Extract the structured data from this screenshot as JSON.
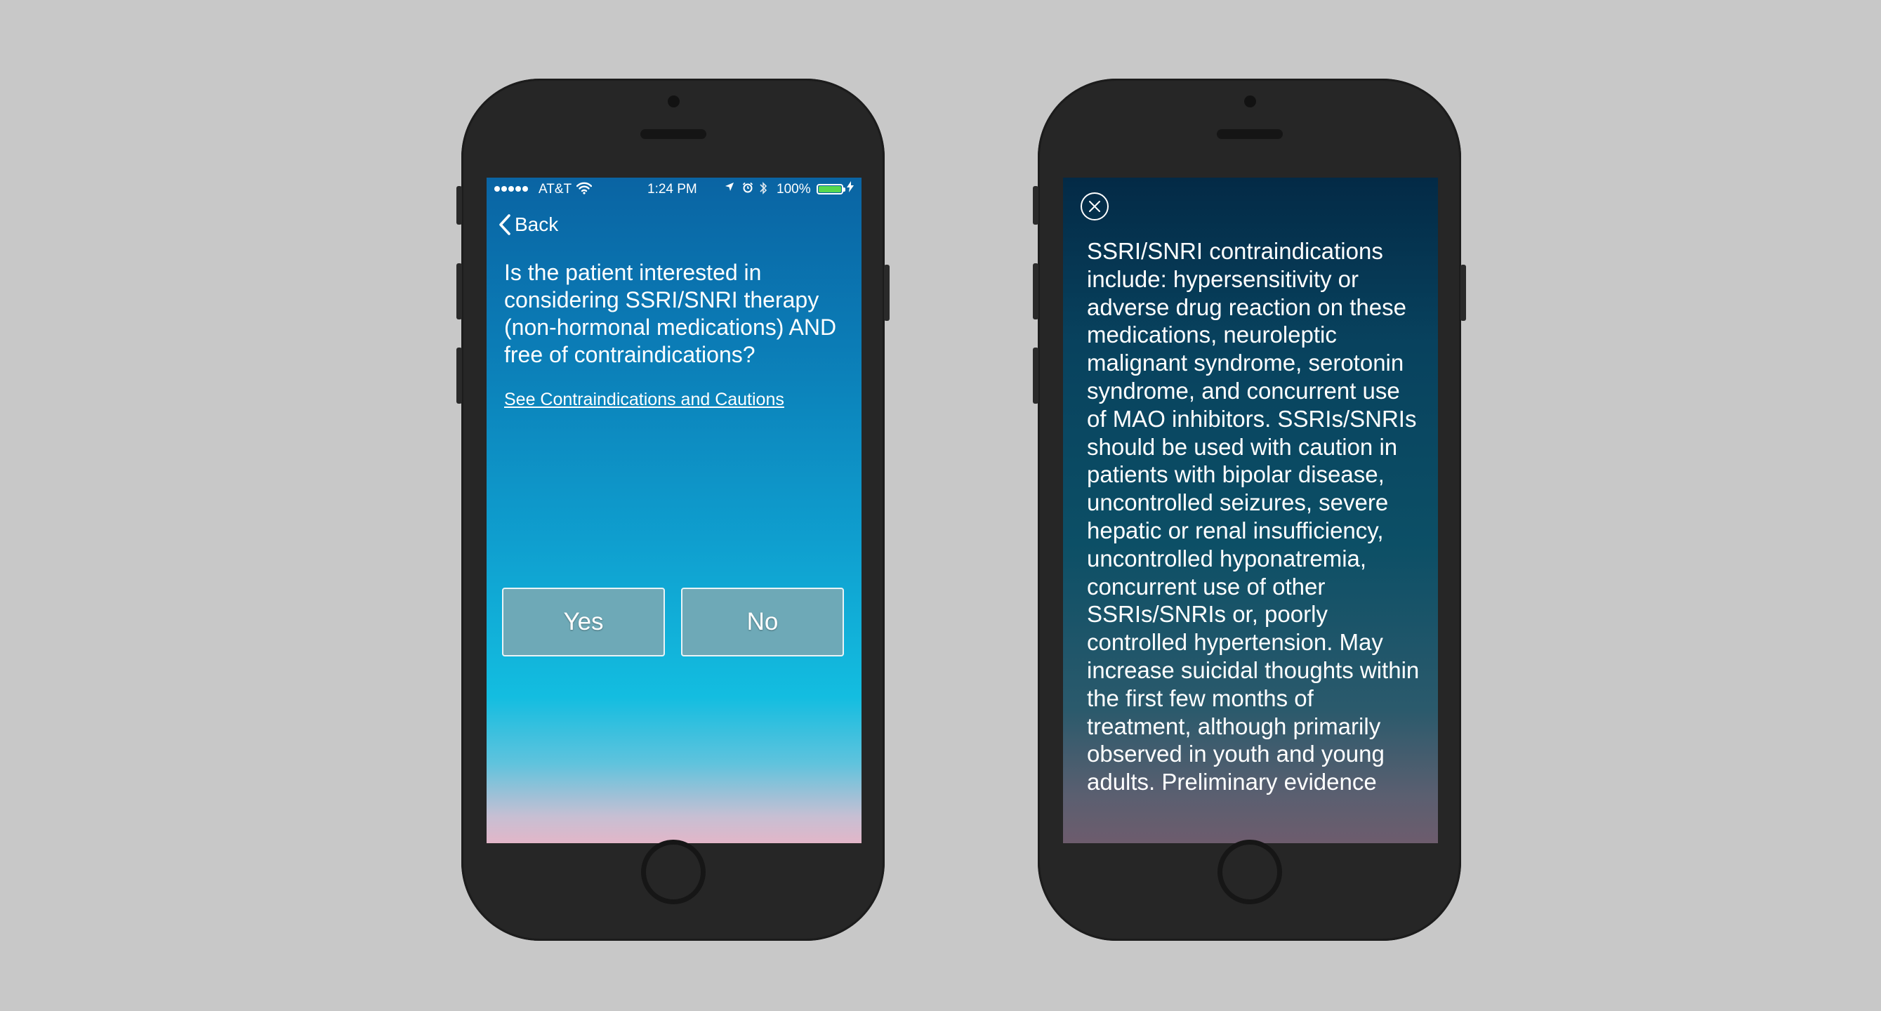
{
  "status_bar": {
    "carrier": "AT&T",
    "time": "1:24 PM",
    "battery_percent": "100%",
    "battery_level": 1.0,
    "icons": [
      "signal-dots-icon",
      "wifi-icon",
      "location-arrow-icon",
      "alarm-icon",
      "bluetooth-icon",
      "battery-icon",
      "charging-bolt-icon"
    ]
  },
  "question_screen": {
    "back_label": "Back",
    "question": "Is the patient interested in considering SSRI/SNRI therapy (non-hormonal medications) AND free of contraindications?",
    "link_label": "See Contraindications and Cautions",
    "yes_label": "Yes",
    "no_label": "No"
  },
  "info_screen": {
    "close_icon": "close-circle-icon",
    "body": "SSRI/SNRI contraindications include: hypersensitivity or adverse drug reaction on these medications, neuroleptic malignant syndrome, serotonin syndrome, and concurrent use of MAO inhibitors. SSRIs/SNRIs should be used with caution in patients with bipolar disease, uncontrolled seizures, severe hepatic or renal insufficiency, uncontrolled hyponatremia, concurrent use of other SSRIs/SNRIs or, poorly controlled hypertension. May increase suicidal thoughts within the first few months of treatment, although primarily observed in youth and young adults. Preliminary evidence"
  },
  "colors": {
    "background": "#c8c8c8",
    "phone_body": "#262626",
    "button_fill": "#6ea9b7",
    "battery_fill": "#56d84e"
  }
}
